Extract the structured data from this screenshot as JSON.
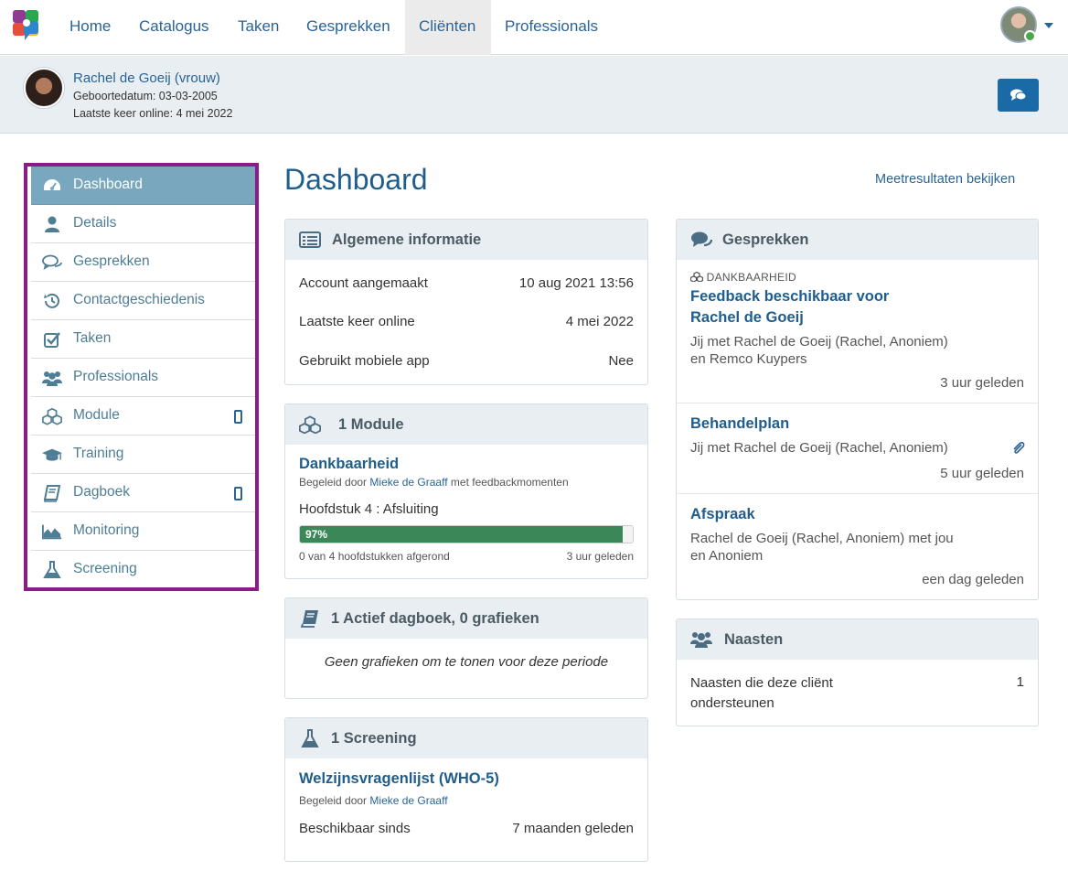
{
  "nav": {
    "items": [
      "Home",
      "Catalogus",
      "Taken",
      "Gesprekken",
      "Cliënten",
      "Professionals"
    ],
    "active": "Cliënten"
  },
  "client": {
    "name": "Rachel de Goeij (vrouw)",
    "birthdate": "Geboortedatum: 03-03-2005",
    "last_online": "Laatste keer online: 4 mei 2022"
  },
  "sidebar": {
    "items": [
      {
        "label": "Dashboard",
        "icon": "dashboard-icon"
      },
      {
        "label": "Details",
        "icon": "user-icon"
      },
      {
        "label": "Gesprekken",
        "icon": "comments-icon"
      },
      {
        "label": "Contactgeschiedenis",
        "icon": "history-icon"
      },
      {
        "label": "Taken",
        "icon": "checkbox-icon"
      },
      {
        "label": "Professionals",
        "icon": "users-icon"
      },
      {
        "label": "Module",
        "icon": "cubes-icon"
      },
      {
        "label": "Training",
        "icon": "graduation-cap-icon"
      },
      {
        "label": "Dagboek",
        "icon": "book-icon"
      },
      {
        "label": "Monitoring",
        "icon": "area-chart-icon"
      },
      {
        "label": "Screening",
        "icon": "flask-icon"
      }
    ]
  },
  "page": {
    "title": "Dashboard",
    "meet_link": "Meetresultaten bekijken"
  },
  "info": {
    "title": "Algemene informatie",
    "rows": [
      {
        "label": "Account aangemaakt",
        "value": "10 aug 2021 13:56"
      },
      {
        "label": "Laatste keer online",
        "value": "4 mei 2022"
      },
      {
        "label": "Gebruikt mobiele app",
        "value": "Nee"
      }
    ]
  },
  "module": {
    "title": "1 Module",
    "name": "Dankbaarheid",
    "guided_prefix": "Begeleid door",
    "guided_by": "Mieke de Graaff",
    "guided_suffix": "met feedbackmomenten",
    "chapter": "Hoofdstuk 4 : Afsluiting",
    "progress_label": "97%",
    "progress": 0.97,
    "chapters_done": "0 van 4 hoofdstukken afgerond",
    "time": "3 uur geleden"
  },
  "diary": {
    "title": "1 Actief dagboek, 0 grafieken",
    "empty": "Geen grafieken om te tonen voor deze periode"
  },
  "screening": {
    "title": "1 Screening",
    "name": "Welzijnsvragenlijst (WHO-5)",
    "guided_prefix": "Begeleid door",
    "guided_by": "Mieke de Graaff",
    "available_label": "Beschikbaar sinds",
    "available_value": "7 maanden geleden"
  },
  "conversations": {
    "title": "Gesprekken",
    "items": [
      {
        "tag": "DANKBAARHEID",
        "title_1": "Feedback beschikbaar voor",
        "title_2": "Rachel de Goeij",
        "text_1": "Jij met Rachel de Goeij (Rachel, Anoniem)",
        "text_2": "en Remco Kuypers",
        "time": "3 uur geleden"
      },
      {
        "title_1": "Behandelplan",
        "text_1": "Jij met Rachel de Goeij (Rachel, Anoniem)",
        "time": "5 uur geleden"
      },
      {
        "title_1": "Afspraak",
        "text_1": "Rachel de Goeij (Rachel, Anoniem) met jou",
        "text_2": "en Anoniem",
        "time": "een dag geleden"
      }
    ]
  },
  "naasten": {
    "title": "Naasten",
    "label_1": "Naasten die deze cliënt",
    "label_2": "ondersteunen",
    "count": "1"
  },
  "colors": {
    "primary": "#1f5d8c",
    "link": "#2a6496",
    "sidebar_active": "#79a7bd",
    "highlight_border": "#8b1b87",
    "progress": "#3c8758"
  }
}
